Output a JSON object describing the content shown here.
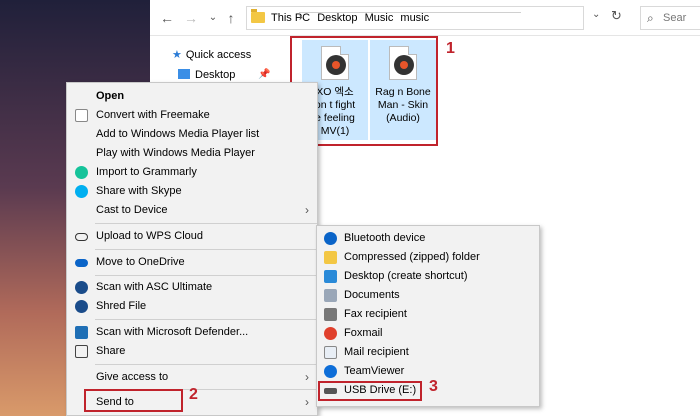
{
  "explorer": {
    "breadcrumb": [
      "This PC",
      "Desktop",
      "Music",
      "music"
    ],
    "search_placeholder": "Sear",
    "nav": {
      "quick_access": "Quick access",
      "desktop": "Desktop"
    },
    "files": [
      {
        "name_lines": [
          "XO 엑소",
          "on t fight",
          "e feeling",
          "MV(1)"
        ]
      },
      {
        "name_lines": [
          "Rag n Bone",
          "Man - Skin",
          "(Audio)"
        ]
      }
    ]
  },
  "steps": [
    "1",
    "2",
    "3"
  ],
  "context_menu": {
    "items": [
      {
        "label": "Open",
        "bold": true
      },
      {
        "label": "Convert with Freemake"
      },
      {
        "label": "Add to Windows Media Player list"
      },
      {
        "label": "Play with Windows Media Player"
      },
      {
        "label": "Import to Grammarly"
      },
      {
        "label": "Share with Skype"
      },
      {
        "label": "Cast to Device",
        "submenu": true
      },
      {
        "label": "Upload to WPS Cloud"
      },
      {
        "label": "Move to OneDrive"
      },
      {
        "label": "Scan with ASC Ultimate"
      },
      {
        "label": "Shred File"
      },
      {
        "label": "Scan with Microsoft Defender..."
      },
      {
        "label": "Share"
      },
      {
        "label": "Give access to",
        "submenu": true
      },
      {
        "label": "Send to",
        "submenu": true
      }
    ]
  },
  "send_to_menu": {
    "items": [
      {
        "label": "Bluetooth device"
      },
      {
        "label": "Compressed (zipped) folder"
      },
      {
        "label": "Desktop (create shortcut)"
      },
      {
        "label": "Documents"
      },
      {
        "label": "Fax recipient"
      },
      {
        "label": "Foxmail"
      },
      {
        "label": "Mail recipient"
      },
      {
        "label": "TeamViewer"
      },
      {
        "label": "USB Drive (E:)"
      }
    ]
  },
  "colors": {
    "highlight": "#cce8ff",
    "annotation_red": "#c0232c",
    "menu_bg": "#f2f2f2"
  }
}
